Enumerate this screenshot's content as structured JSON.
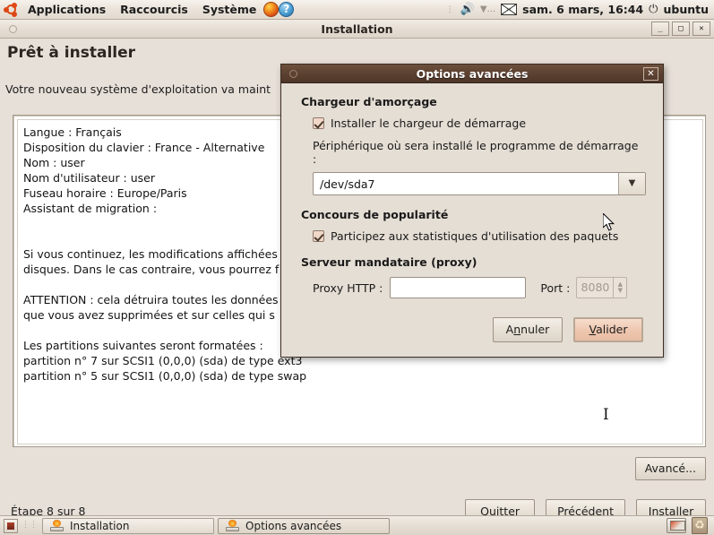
{
  "panel": {
    "logo_icon": "ubuntu-logo-icon",
    "menus": [
      "Applications",
      "Raccourcis",
      "Système"
    ],
    "firefox_icon": "firefox-icon",
    "help_icon": "help-icon",
    "volume_icon": "volume-icon",
    "network_icon": "network-icon",
    "mail_icon": "mail-icon",
    "clock": "sam.  6 mars, 16:44",
    "power_icon": "power-icon",
    "user": "ubuntu"
  },
  "main_window": {
    "title": "Installation",
    "minimize_label": "_",
    "maximize_label": "□",
    "close_label": "✕",
    "heading": "Prêt à installer",
    "intro": "Votre nouveau système d'exploitation va maint",
    "summary_lines": [
      "Langue : Français",
      "Disposition du clavier : France - Alternative",
      "Nom : user",
      "Nom d'utilisateur : user",
      "Fuseau horaire : Europe/Paris",
      "Assistant de migration :",
      "",
      "",
      "Si vous continuez, les modifications affichées",
      "disques. Dans le cas contraire, vous pourrez f",
      "",
      "ATTENTION : cela détruira toutes les données",
      "que vous avez supprimées et sur celles qui s",
      "",
      "Les partitions suivantes seront formatées :",
      " partition n° 7  sur SCSI1 (0,0,0) (sda) de type ext3",
      " partition n° 5 sur SCSI1 (0,0,0) (sda) de type swap"
    ],
    "advanced_button": "Avancé...",
    "step_label": "Étape 8 sur 8",
    "buttons": [
      {
        "label": "Quitter",
        "mnemonic_index": 0
      },
      {
        "label": "Précédent",
        "mnemonic_index": 0
      },
      {
        "label": "Installer",
        "mnemonic_index": -1
      }
    ]
  },
  "dialog": {
    "title": "Options avancées",
    "close_label": "✕",
    "bootloader": {
      "section_title": "Chargeur d'amorçage",
      "checkbox_label": "Installer le chargeur de démarrage",
      "checkbox_checked": true,
      "device_label": "Périphérique où sera installé le programme de démarrage :",
      "device_value": "/dev/sda7",
      "dropdown_icon": "chevron-down-icon"
    },
    "popularity": {
      "section_title": "Concours de popularité",
      "checkbox_label": "Participez aux statistiques d'utilisation des paquets",
      "checkbox_checked": true
    },
    "proxy": {
      "section_title": "Serveur mandataire (proxy)",
      "http_label": "Proxy HTTP :",
      "http_value": "",
      "port_label": "Port :",
      "port_value": "8080"
    },
    "cancel_button": "Annuler",
    "ok_button": "Valider"
  },
  "taskbar": {
    "show_desktop_icon": "show-desktop-icon",
    "tasks": [
      {
        "label": "Installation",
        "active": false,
        "icon": "installer-icon"
      },
      {
        "label": "Options avancées",
        "active": true,
        "icon": "installer-icon"
      }
    ],
    "workspace_icon": "workspace-switcher-icon",
    "trash_icon": "trash-icon"
  },
  "colors": {
    "panel_bg": "#eae3da",
    "window_bg": "#e7e0d8",
    "dialog_titlebar": "#5b4031",
    "accent_orange": "#dd4814",
    "primary_button": "#eec6ae"
  }
}
